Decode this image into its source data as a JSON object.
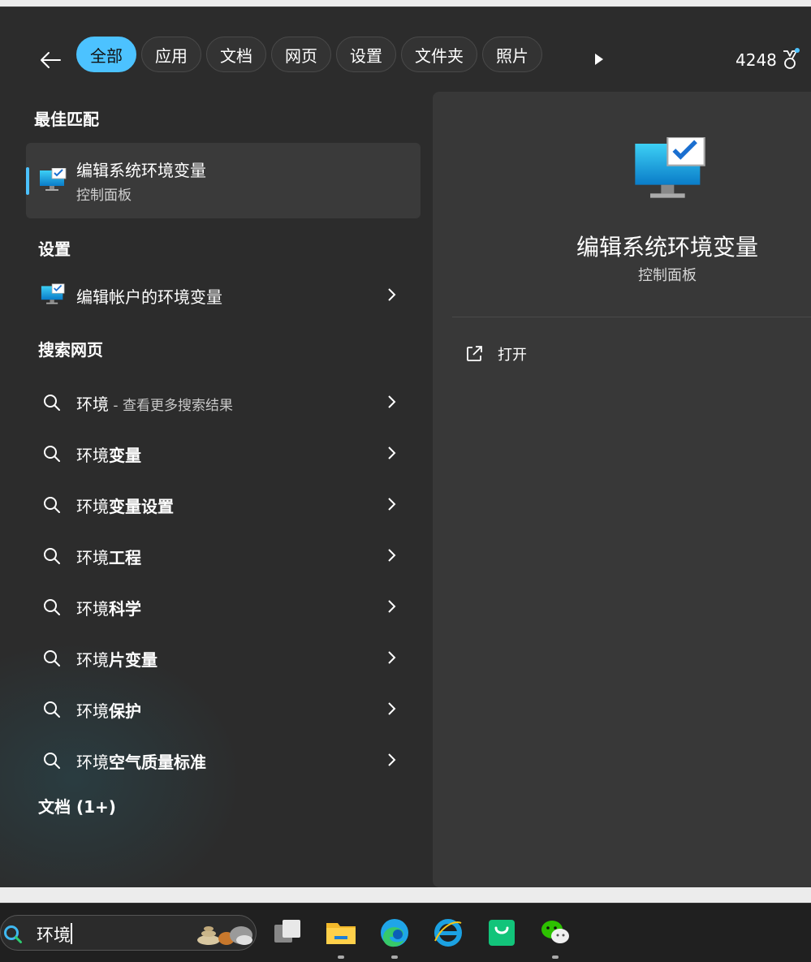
{
  "filters": {
    "back_label": "Back",
    "tabs": [
      {
        "label": "全部",
        "active": true
      },
      {
        "label": "应用",
        "active": false
      },
      {
        "label": "文档",
        "active": false
      },
      {
        "label": "网页",
        "active": false
      },
      {
        "label": "设置",
        "active": false
      },
      {
        "label": "文件夹",
        "active": false
      },
      {
        "label": "照片",
        "active": false
      }
    ],
    "points": "4248"
  },
  "best_match": {
    "heading": "最佳匹配",
    "title": "编辑系统环境变量",
    "subtitle": "控制面板",
    "icon": "monitor-check-icon"
  },
  "settings": {
    "heading": "设置",
    "items": [
      {
        "label": "编辑帐户的环境变量",
        "icon": "monitor-check-icon"
      }
    ]
  },
  "web": {
    "heading": "搜索网页",
    "items": [
      {
        "prefix": "环境",
        "bold": "",
        "suffix": " - 查看更多搜索结果"
      },
      {
        "prefix": "环境",
        "bold": "变量",
        "suffix": ""
      },
      {
        "prefix": "环境",
        "bold": "变量设置",
        "suffix": ""
      },
      {
        "prefix": "环境",
        "bold": "工程",
        "suffix": ""
      },
      {
        "prefix": "环境",
        "bold": "科学",
        "suffix": ""
      },
      {
        "prefix": "环境",
        "bold": "片变量",
        "suffix": ""
      },
      {
        "prefix": "环境",
        "bold": "保护",
        "suffix": ""
      },
      {
        "prefix": "环境",
        "bold": "空气质量标准",
        "suffix": ""
      }
    ]
  },
  "documents": {
    "heading": "文档 (1+)"
  },
  "detail": {
    "title": "编辑系统环境变量",
    "subtitle": "控制面板",
    "open_label": "打开"
  },
  "taskbar": {
    "search_value": "环境",
    "apps": [
      "task-view-icon",
      "file-explorer-icon",
      "edge-icon",
      "ie-icon",
      "store-bag-icon",
      "wechat-icon"
    ]
  },
  "colors": {
    "accent": "#4cc2ff",
    "panel": "#2c2c2c",
    "detail": "#383838"
  }
}
